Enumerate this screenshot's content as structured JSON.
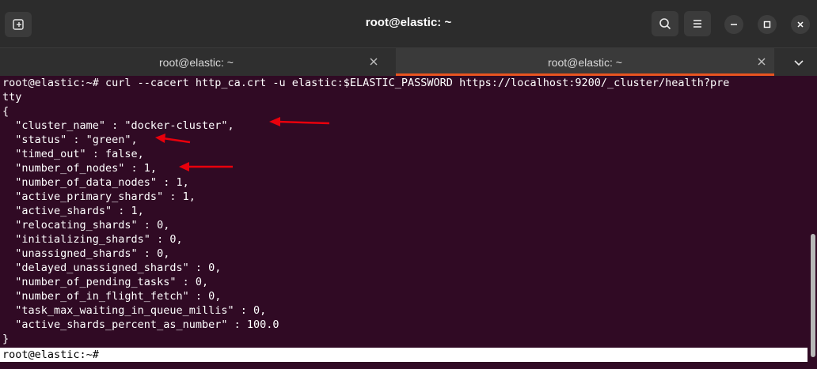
{
  "window": {
    "title": "root@elastic: ~",
    "buttons": {
      "new_tab_icon": "new-tab-icon",
      "search_icon": "search-icon",
      "menu_icon": "hamburger-menu-icon",
      "minimize_icon": "minimize-icon",
      "maximize_icon": "maximize-icon",
      "close_icon": "close-icon"
    }
  },
  "tabs": [
    {
      "label": "root@elastic: ~",
      "active": false
    },
    {
      "label": "root@elastic: ~",
      "active": true
    }
  ],
  "terminal": {
    "lines": [
      "root@elastic:~# curl --cacert http_ca.crt -u elastic:$ELASTIC_PASSWORD https://localhost:9200/_cluster/health?pre",
      "tty",
      "{",
      "  \"cluster_name\" : \"docker-cluster\",",
      "  \"status\" : \"green\",",
      "  \"timed_out\" : false,",
      "  \"number_of_nodes\" : 1,",
      "  \"number_of_data_nodes\" : 1,",
      "  \"active_primary_shards\" : 1,",
      "  \"active_shards\" : 1,",
      "  \"relocating_shards\" : 0,",
      "  \"initializing_shards\" : 0,",
      "  \"unassigned_shards\" : 0,",
      "  \"delayed_unassigned_shards\" : 0,",
      "  \"number_of_pending_tasks\" : 0,",
      "  \"number_of_in_flight_fetch\" : 0,",
      "  \"task_max_waiting_in_queue_millis\" : 0,",
      "  \"active_shards_percent_as_number\" : 100.0",
      "}"
    ],
    "prompt": "root@elastic:~# "
  },
  "colors": {
    "terminal_background": "#300a24",
    "terminal_text": "#ffffff",
    "titlebar": "#2c2c2c",
    "tab_active_accent": "#e95420",
    "annotation_arrow": "#e8000c"
  }
}
